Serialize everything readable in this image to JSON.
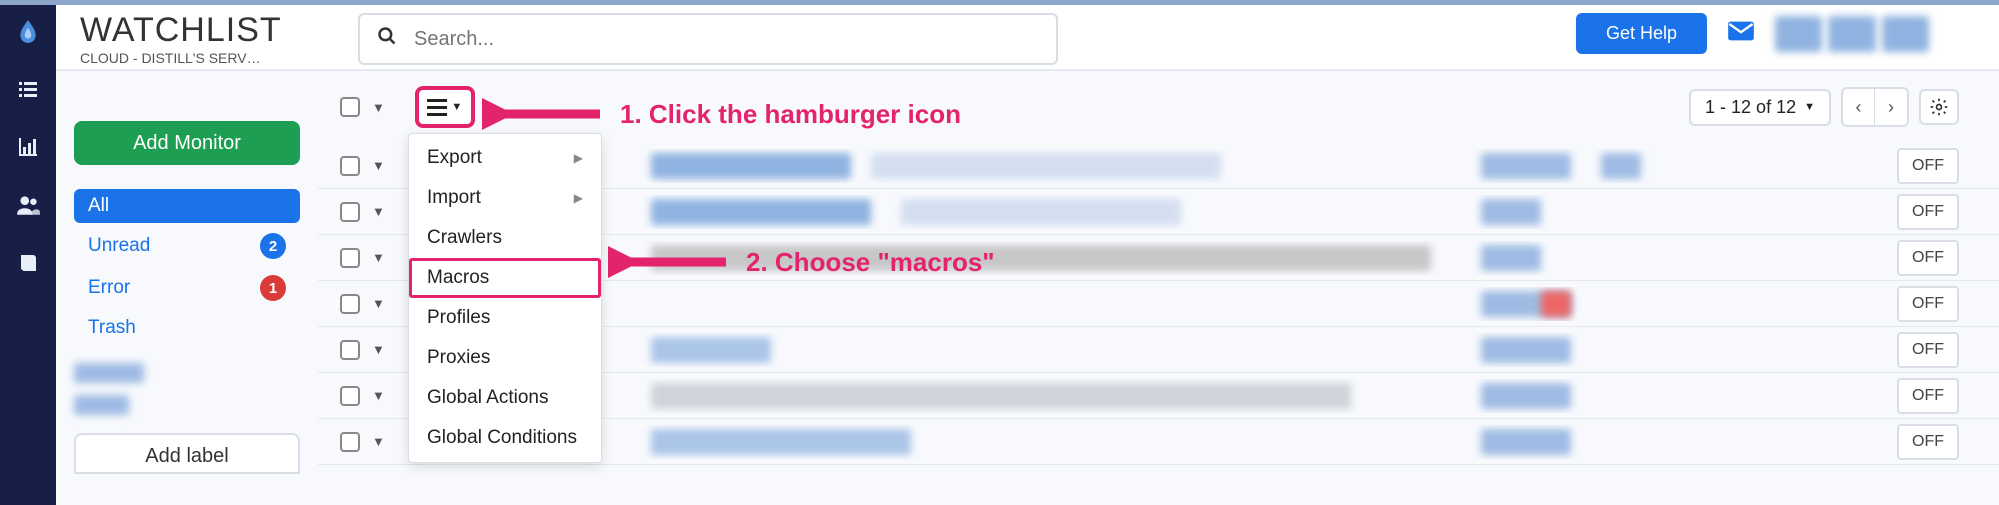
{
  "header": {
    "title": "WATCHLIST",
    "subtitle": "CLOUD - DISTILL'S SERV…",
    "search_placeholder": "Search...",
    "help_label": "Get Help"
  },
  "sidebar": {
    "add_monitor_label": "Add Monitor",
    "items": [
      {
        "label": "All",
        "active": true,
        "badge": null
      },
      {
        "label": "Unread",
        "active": false,
        "badge": "2",
        "badge_color": "blue"
      },
      {
        "label": "Error",
        "active": false,
        "badge": "1",
        "badge_color": "red"
      },
      {
        "label": "Trash",
        "active": false,
        "badge": null
      }
    ],
    "add_label_label": "Add label"
  },
  "toolbar": {
    "pager_text": "1 - 12 of 12",
    "menu": [
      {
        "label": "Export",
        "submenu": true
      },
      {
        "label": "Import",
        "submenu": true
      },
      {
        "label": "Crawlers"
      },
      {
        "label": "Macros",
        "highlight": true
      },
      {
        "label": "Profiles"
      },
      {
        "label": "Proxies"
      },
      {
        "label": "Global Actions"
      },
      {
        "label": "Global Conditions"
      }
    ]
  },
  "rows": {
    "off_label": "OFF",
    "count": 7
  },
  "annotations": {
    "a1": "1. Click the hamburger icon",
    "a2": "2. Choose \"macros\""
  },
  "colors": {
    "accent_pink": "#e4236d",
    "primary_blue": "#1a73e8",
    "green": "#1e9e52",
    "rail": "#181f46"
  }
}
